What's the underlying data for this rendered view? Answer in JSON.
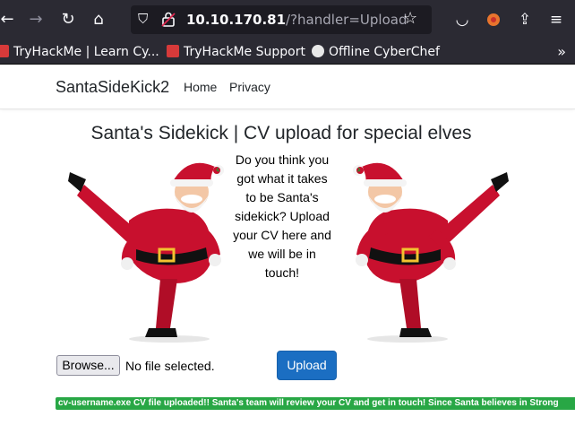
{
  "browser": {
    "url_host": "10.10.170.81",
    "url_path": "/?handler=Upload",
    "bookmarks": [
      {
        "label": "TryHackMe | Learn Cy...",
        "color": "#d73a3a"
      },
      {
        "label": "TryHackMe Support",
        "color": "#d73a3a"
      },
      {
        "label": "Offline CyberChef",
        "color": "#e8e8e8"
      }
    ]
  },
  "navbar": {
    "brand": "SantaSideKick2",
    "links": [
      "Home",
      "Privacy"
    ]
  },
  "main": {
    "heading": "Santa's Sidekick | CV upload for special elves",
    "blurb": "Do you think you got what it takes to be Santa's sidekick? Upload your CV here and we will be in touch!",
    "file_button": "Browse...",
    "file_status": "No file selected.",
    "upload_button": "Upload",
    "alert": "cv-username.exe CV file uploaded!! Santa's team will review your CV and get in touch! Since Santa believes in Strong"
  },
  "colors": {
    "accent": "#1b6ec2",
    "success": "#28a745",
    "chrome": "#2b2a33"
  }
}
